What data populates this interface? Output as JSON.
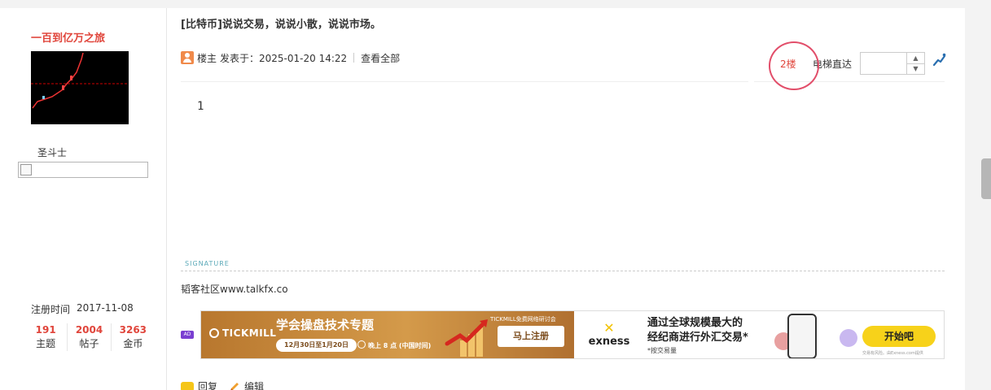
{
  "author": {
    "username": "一百到亿万之旅",
    "rank": "圣斗士",
    "reg_label": "注册时间",
    "reg_date": "2017-11-08",
    "stats": [
      {
        "num": "191",
        "label": "主题"
      },
      {
        "num": "2004",
        "label": "帖子"
      },
      {
        "num": "3263",
        "label": "金币"
      }
    ]
  },
  "post": {
    "title": "[比特币]说说交易，说说小散，说说市场。",
    "role": "楼主",
    "posted": "发表于：2025-01-20 14:22",
    "view_all": "查看全部",
    "floor": "2楼",
    "elevator_label": "电梯直达",
    "content": "1",
    "signature_label": "SIGNATURE",
    "signature_text": "韬客社区www.talkfx.co"
  },
  "ad": {
    "badge": "AD",
    "left": {
      "brand": "TICKMILL",
      "title": "学会操盘技术专题",
      "date": "12月30日至1月20日",
      "time": "晚上 8 点 (中国时间)",
      "seminar": "TICKMILL免费网络研讨会",
      "cta": "马上注册"
    },
    "right": {
      "brand": "exness",
      "line1": "通过全球规模最大的",
      "line2": "经纪商进行外汇交易*",
      "sub": "*按交易量",
      "cta": "开始吧",
      "fine": "交易有风险。由Exness.com提供"
    }
  },
  "actions": {
    "reply": "回复",
    "edit": "编辑"
  },
  "colors": {
    "accent_red": "#e0453b",
    "circle": "#e24e6a",
    "signature": "#5aa9b8"
  }
}
